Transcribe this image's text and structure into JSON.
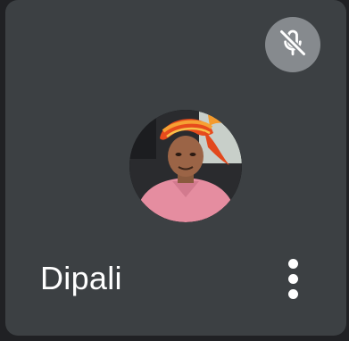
{
  "participant": {
    "name": "Dipali",
    "mic_state_icon": "mic-off-icon",
    "more_options_icon": "more-vertical-icon"
  }
}
